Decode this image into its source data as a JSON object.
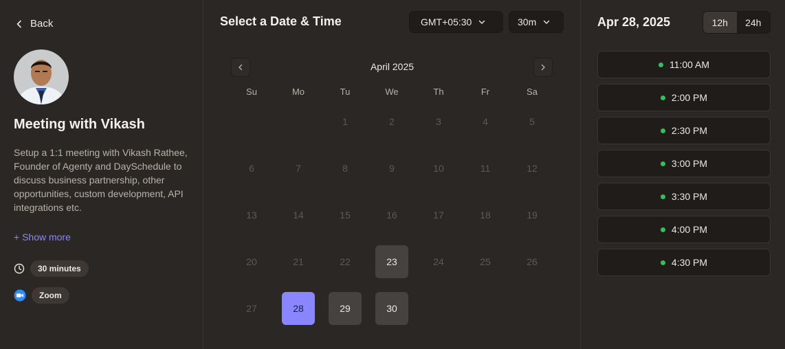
{
  "profile": {
    "back_label": "Back",
    "title": "Meeting with Vikash",
    "description": "Setup a 1:1 meeting with Vikash Rathee, Founder of Agenty and DaySchedule to discuss business partnership, other opportunities, custom development, API integrations etc.",
    "show_more": "+ Show more",
    "duration": "30 minutes",
    "location": "Zoom"
  },
  "calendar": {
    "heading": "Select a Date & Time",
    "timezone": "GMT+05:30",
    "duration_select": "30m",
    "month_label": "April 2025",
    "weekdays": [
      "Su",
      "Mo",
      "Tu",
      "We",
      "Th",
      "Fr",
      "Sa"
    ],
    "first_weekday_index": 2,
    "days_in_month": 30,
    "available_days": [
      23,
      29,
      30
    ],
    "selected_day": 28
  },
  "slots_panel": {
    "date_title": "Apr 28, 2025",
    "format_12": "12h",
    "format_24": "24h",
    "active_format": "12h",
    "slots": [
      "11:00 AM",
      "2:00 PM",
      "2:30 PM",
      "3:00 PM",
      "3:30 PM",
      "4:00 PM",
      "4:30 PM"
    ],
    "available_color": "#2ec25a",
    "accent_color": "#8a86ff"
  }
}
